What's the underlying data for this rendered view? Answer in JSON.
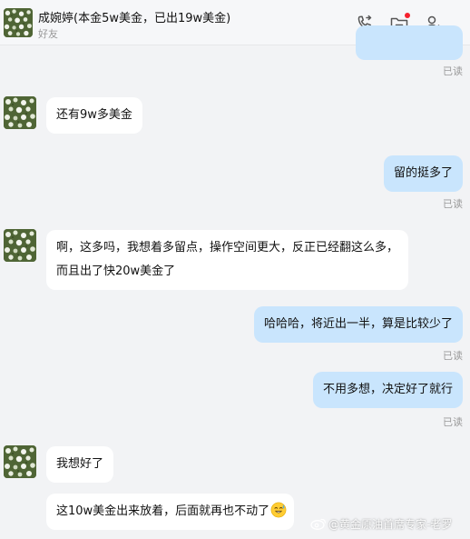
{
  "header": {
    "title": "成婉婷(本金5w美金，已出19w美金)",
    "subtitle": "好友",
    "icons": [
      "phone-icon",
      "folder-icon",
      "add-friend-icon"
    ]
  },
  "messages": [
    {
      "dir": "out",
      "text": "",
      "read": "已读"
    },
    {
      "dir": "in",
      "text": "还有9w多美金"
    },
    {
      "dir": "out",
      "text": "留的挺多了",
      "read": "已读"
    },
    {
      "dir": "in",
      "line1": "啊，这多吗，我想着多留点，操作空间更大，反正已经翻这么多，",
      "line2": "而且出了快20w美金了"
    },
    {
      "dir": "out",
      "text": "哈哈哈，将近出一半，算是比较少了",
      "read": "已读"
    },
    {
      "dir": "out",
      "text": "不用多想，决定好了就行",
      "read": "已读"
    },
    {
      "dir": "in",
      "text": "我想好了"
    },
    {
      "dir": "in",
      "text": "这10w美金出来放着，后面就再也不动了",
      "emoji": "sweat-smile-emoji"
    }
  ],
  "watermark": "@黄金原油首席专家-老罗",
  "colors": {
    "background": "#f2f3f5",
    "outgoing_bubble": "#c9e5fd",
    "incoming_bubble": "#ffffff",
    "read_text": "#9a9a9a",
    "notification_dot": "#f5212d"
  }
}
